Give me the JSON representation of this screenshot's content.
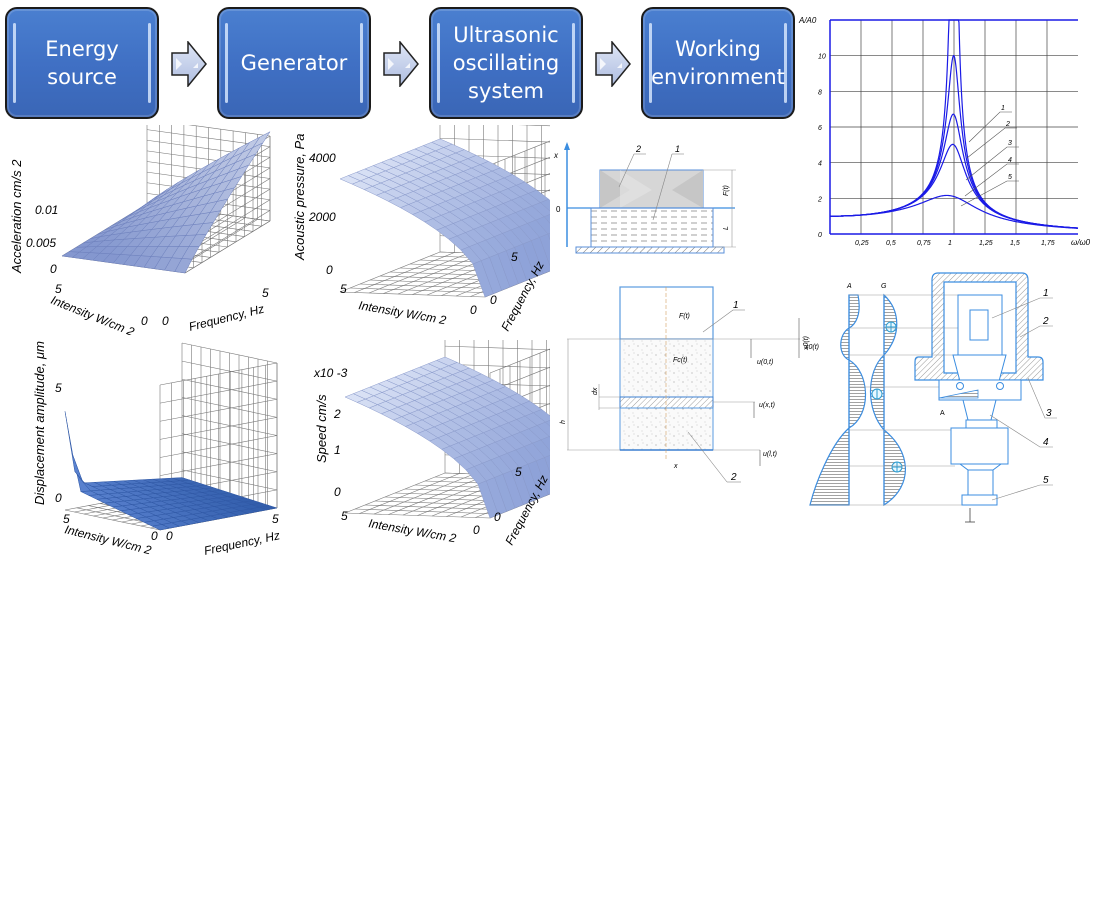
{
  "flow": {
    "boxes": [
      {
        "label": "Energy\nsource"
      },
      {
        "label": "Generator"
      },
      {
        "label": "Ultrasonic\noscillating\nsystem"
      },
      {
        "label": "Working\nenvironment"
      }
    ],
    "arrow_icon": "right-arrow",
    "box_color": "#3f6fc3"
  },
  "chart_data": [
    {
      "type": "line",
      "title": "",
      "ylabel": "A/A0",
      "xlabel": "ω/ω0",
      "xlim": [
        0,
        2
      ],
      "ylim": [
        0,
        12
      ],
      "x_ticks": [
        "0,25",
        "0,5",
        "0,75",
        "1",
        "1,25",
        "1,5",
        "1,75"
      ],
      "y_ticks": [
        "0",
        "2",
        "4",
        "6",
        "8",
        "10"
      ],
      "grid": true,
      "line_color": "#1a1ae6",
      "series": [
        {
          "name": "1",
          "peak": 50
        },
        {
          "name": "2",
          "peak": 10
        },
        {
          "name": "3",
          "peak": 6.7
        },
        {
          "name": "4",
          "peak": 5
        },
        {
          "name": "5",
          "peak": 2.1
        }
      ],
      "curve_labels": [
        "1",
        "2",
        "3",
        "4",
        "5"
      ]
    },
    {
      "type": "surface",
      "zlabel": "Acceleration cm/s 2",
      "z_ticks": [
        "0",
        "0.005",
        "0.01"
      ],
      "xlabel": "Intensity W/cm 2",
      "x_ticks": [
        "5",
        "0"
      ],
      "ylabel": "Frequency, Hz",
      "y_ticks": [
        "0",
        "5"
      ],
      "zlim": [
        0,
        0.015
      ]
    },
    {
      "type": "surface",
      "zlabel": "Acoustic pressure, Pa",
      "z_ticks": [
        "0",
        "2000",
        "4000"
      ],
      "xlabel": "Intensity W/cm 2",
      "x_ticks": [
        "5",
        "0"
      ],
      "ylabel": "Frequency, Hz",
      "y_ticks": [
        "0",
        "5"
      ],
      "zlim": [
        0,
        4500
      ]
    },
    {
      "type": "surface",
      "zlabel": "Displacement amplitude, μm",
      "z_ticks": [
        "0",
        "5"
      ],
      "xlabel": "Intensity W/cm 2",
      "x_ticks": [
        "5",
        "0"
      ],
      "ylabel": "Frequency, Hz",
      "y_ticks": [
        "0",
        "5"
      ],
      "zlim": [
        0,
        5
      ]
    },
    {
      "type": "surface",
      "zlabel": "Speed cm/s",
      "z_multiplier": "x10 -3",
      "z_ticks": [
        "0",
        "1",
        "2"
      ],
      "xlabel": "Intensity W/cm 2",
      "x_ticks": [
        "5",
        "0"
      ],
      "ylabel": "Frequency, Hz",
      "y_ticks": [
        "0",
        "5"
      ],
      "zlim": [
        0,
        3
      ]
    }
  ],
  "diagram_layer": {
    "labels": {
      "x": "x",
      "zero": "0",
      "F": "F(t)",
      "L": "L",
      "num1": "1",
      "num2": "2"
    }
  },
  "diagram_column": {
    "labels": {
      "F": "F(t)",
      "Fc": "Fc(t)",
      "dx": "dx",
      "h": "h",
      "x": "x",
      "u0": "u(0,t)",
      "ux": "u(x,t)",
      "ul": "u(l,t)",
      "x0": "x0(t)",
      "num1": "1",
      "num2": "2"
    }
  },
  "diagram_transducer": {
    "labels": {
      "A": "A",
      "G": "G",
      "x0": "x0(t)",
      "A2": "A",
      "nums": [
        "1",
        "2",
        "3",
        "4",
        "5"
      ]
    }
  }
}
